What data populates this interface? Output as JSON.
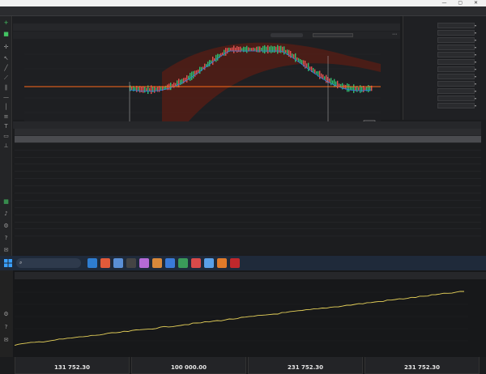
{
  "titlebar": {
    "window_controls": "— ▢ ✕"
  },
  "menubar": {
    "tabs": []
  },
  "chart": {
    "tabs": [],
    "price_ticks": [],
    "date_ticks": [],
    "indicator_color": "#2a7de1",
    "candle_up": "#2fbf71",
    "candle_down": "#e05252",
    "levelline_color": "#ff6a1a"
  },
  "params": [
    {
      "label": "",
      "value": ""
    },
    {
      "label": "",
      "value": ""
    },
    {
      "label": "",
      "value": ""
    },
    {
      "label": "",
      "value": ""
    },
    {
      "label": "",
      "value": ""
    },
    {
      "label": "",
      "value": ""
    },
    {
      "label": "",
      "value": ""
    },
    {
      "label": "",
      "value": ""
    },
    {
      "label": "",
      "value": ""
    },
    {
      "label": "",
      "value": ""
    },
    {
      "label": "",
      "value": ""
    },
    {
      "label": "",
      "value": ""
    }
  ],
  "results": {
    "tabs": [],
    "rows": [
      {
        "name": "",
        "all": "",
        "long": "",
        "short": ""
      },
      {
        "name": "",
        "all": "",
        "long": "",
        "short": ""
      },
      {
        "name": "",
        "all": "",
        "long": "",
        "short": ""
      },
      {
        "name": "",
        "all": "",
        "long": "",
        "short": ""
      },
      {
        "name": "",
        "all": "",
        "long": "",
        "short": ""
      },
      {
        "name": "",
        "all": "",
        "long": "",
        "short": ""
      },
      {
        "name": "",
        "all": "",
        "long": "",
        "short": ""
      },
      {
        "name": "",
        "all": "",
        "long": "",
        "short": ""
      },
      {
        "name": "",
        "all": "",
        "long": "",
        "short": ""
      },
      {
        "name": "",
        "all": "",
        "long": "",
        "short": ""
      },
      {
        "name": "",
        "all": "",
        "long": "",
        "short": ""
      },
      {
        "name": "",
        "all": "",
        "long": "",
        "short": ""
      },
      {
        "name": "",
        "all": "",
        "long": "",
        "short": ""
      },
      {
        "name": "",
        "all": "",
        "long": "",
        "short": ""
      },
      {
        "name": "",
        "all": "",
        "long": "",
        "short": ""
      }
    ],
    "totals": [
      {
        "label": "",
        "value": "131 752.30"
      },
      {
        "label": "",
        "value": "100 000.00"
      },
      {
        "label": "",
        "value": "231 752.30"
      },
      {
        "label": "",
        "value": "231 752.30"
      }
    ]
  },
  "taskbar": {
    "search_placeholder": "",
    "clock": ""
  },
  "bottom": {
    "tabs": [],
    "equity_color": "#e8d35a"
  }
}
